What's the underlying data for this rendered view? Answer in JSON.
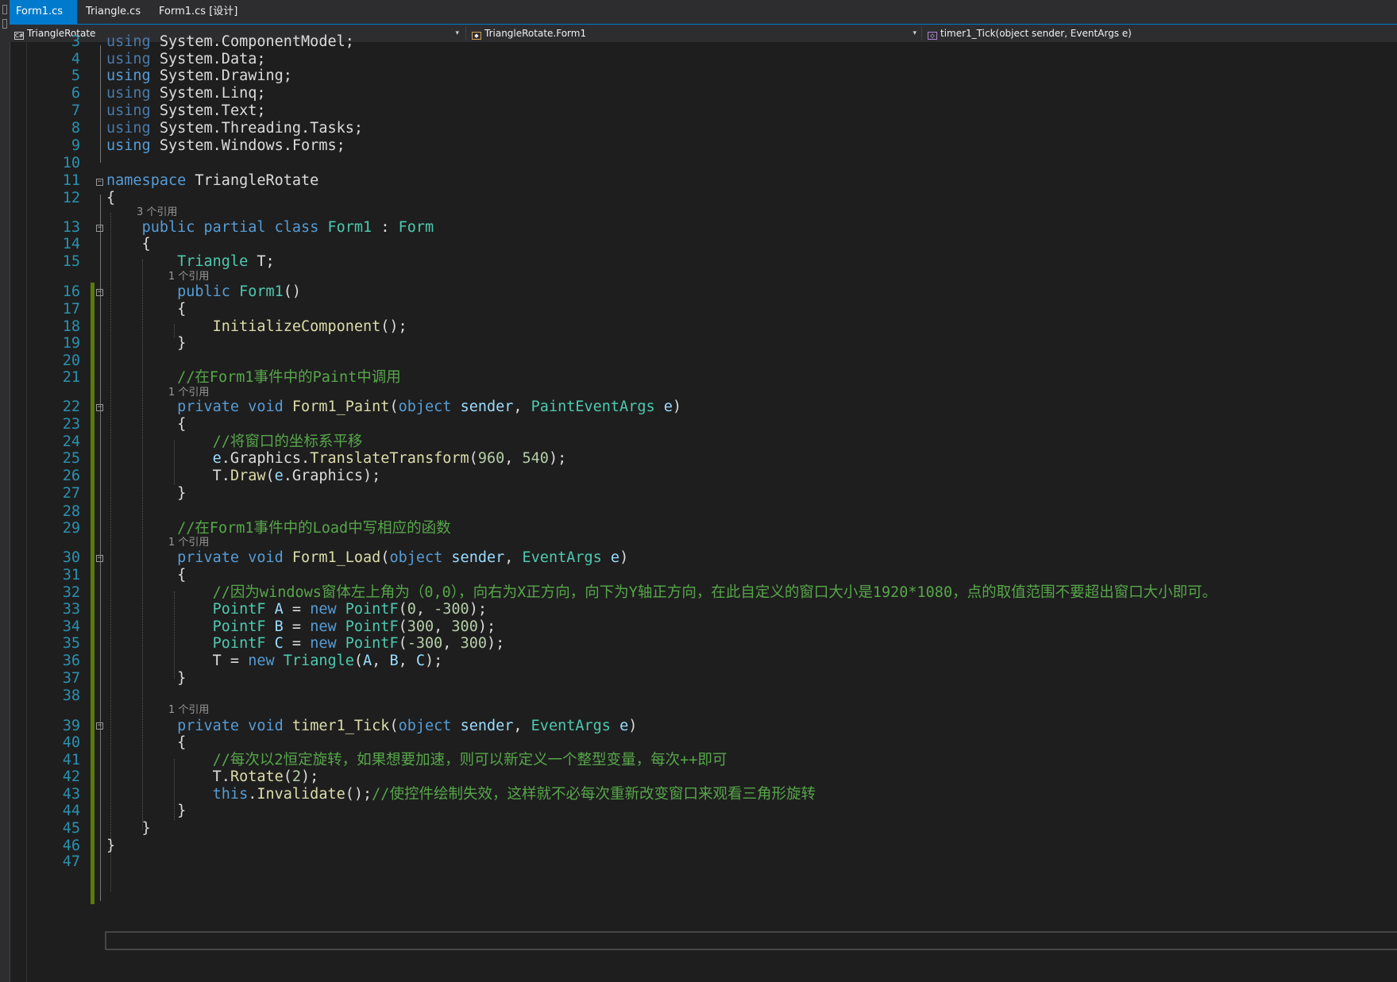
{
  "tabs": [
    {
      "label": "Form1.cs",
      "active": true
    },
    {
      "label": "Triangle.cs",
      "active": false
    },
    {
      "label": "Form1.cs [设计]",
      "active": false
    }
  ],
  "nav": {
    "project": "TriangleRotate",
    "class": "TriangleRotate.Form1",
    "member": "timer1_Tick(object sender, EventArgs e)"
  },
  "refs": {
    "r13": "3 个引用",
    "r16": "1 个引用",
    "r22": "1 个引用",
    "r30": "1 个引用",
    "r39": "1 个引用"
  },
  "lines": [
    {
      "n": "3",
      "tokens": [
        [
          "kw-dim",
          "using"
        ],
        [
          "pl",
          " System.ComponentModel;"
        ]
      ]
    },
    {
      "n": "4",
      "tokens": [
        [
          "kw-dim",
          "using"
        ],
        [
          "pl",
          " System.Data;"
        ]
      ]
    },
    {
      "n": "5",
      "tokens": [
        [
          "kw",
          "using"
        ],
        [
          "pl",
          " System.Drawing;"
        ]
      ]
    },
    {
      "n": "6",
      "tokens": [
        [
          "kw-dim",
          "using"
        ],
        [
          "pl",
          " System.Linq;"
        ]
      ]
    },
    {
      "n": "7",
      "tokens": [
        [
          "kw-dim",
          "using"
        ],
        [
          "pl",
          " System.Text;"
        ]
      ]
    },
    {
      "n": "8",
      "tokens": [
        [
          "kw-dim",
          "using"
        ],
        [
          "pl",
          " System.Threading.Tasks;"
        ]
      ]
    },
    {
      "n": "9",
      "tokens": [
        [
          "kw",
          "using"
        ],
        [
          "pl",
          " System.Windows.Forms;"
        ]
      ]
    },
    {
      "n": "10",
      "tokens": []
    },
    {
      "n": "11",
      "tokens": [
        [
          "kw",
          "namespace"
        ],
        [
          "pl",
          " TriangleRotate"
        ]
      ]
    },
    {
      "n": "12",
      "tokens": [
        [
          "pl",
          "{"
        ]
      ]
    },
    {
      "n": "13",
      "tokens": [
        [
          "pl",
          "    "
        ],
        [
          "kw",
          "public"
        ],
        [
          "pl",
          " "
        ],
        [
          "kw",
          "partial"
        ],
        [
          "pl",
          " "
        ],
        [
          "kw",
          "class"
        ],
        [
          "pl",
          " "
        ],
        [
          "ty",
          "Form1"
        ],
        [
          "pl",
          " : "
        ],
        [
          "ty",
          "Form"
        ]
      ]
    },
    {
      "n": "14",
      "tokens": [
        [
          "pl",
          "    {"
        ]
      ]
    },
    {
      "n": "15",
      "tokens": [
        [
          "pl",
          "        "
        ],
        [
          "ty",
          "Triangle"
        ],
        [
          "pl",
          " T;"
        ]
      ]
    },
    {
      "n": "16",
      "tokens": [
        [
          "pl",
          "        "
        ],
        [
          "kw",
          "public"
        ],
        [
          "pl",
          " "
        ],
        [
          "ty",
          "Form1"
        ],
        [
          "pl",
          "()"
        ]
      ]
    },
    {
      "n": "17",
      "tokens": [
        [
          "pl",
          "        {"
        ]
      ]
    },
    {
      "n": "18",
      "tokens": [
        [
          "pl",
          "            "
        ],
        [
          "fn",
          "InitializeComponent"
        ],
        [
          "pl",
          "();"
        ]
      ]
    },
    {
      "n": "19",
      "tokens": [
        [
          "pl",
          "        }"
        ]
      ]
    },
    {
      "n": "20",
      "tokens": []
    },
    {
      "n": "21",
      "tokens": [
        [
          "pl",
          "        "
        ],
        [
          "cm",
          "//在Form1事件中的Paint中调用"
        ]
      ]
    },
    {
      "n": "22",
      "tokens": [
        [
          "pl",
          "        "
        ],
        [
          "kw",
          "private"
        ],
        [
          "pl",
          " "
        ],
        [
          "kw",
          "void"
        ],
        [
          "pl",
          " "
        ],
        [
          "fn",
          "Form1_Paint"
        ],
        [
          "pl",
          "("
        ],
        [
          "kw",
          "object"
        ],
        [
          "pl",
          " "
        ],
        [
          "id",
          "sender"
        ],
        [
          "pl",
          ", "
        ],
        [
          "ty",
          "PaintEventArgs"
        ],
        [
          "pl",
          " "
        ],
        [
          "id",
          "e"
        ],
        [
          "pl",
          ")"
        ]
      ]
    },
    {
      "n": "23",
      "tokens": [
        [
          "pl",
          "        {"
        ]
      ]
    },
    {
      "n": "24",
      "tokens": [
        [
          "pl",
          "            "
        ],
        [
          "cm",
          "//将窗口的坐标系平移"
        ]
      ]
    },
    {
      "n": "25",
      "tokens": [
        [
          "pl",
          "            "
        ],
        [
          "id",
          "e"
        ],
        [
          "pl",
          ".Graphics."
        ],
        [
          "fn",
          "TranslateTransform"
        ],
        [
          "pl",
          "("
        ],
        [
          "nm",
          "960"
        ],
        [
          "pl",
          ", "
        ],
        [
          "nm",
          "540"
        ],
        [
          "pl",
          ");"
        ]
      ]
    },
    {
      "n": "26",
      "tokens": [
        [
          "pl",
          "            T."
        ],
        [
          "fn",
          "Draw"
        ],
        [
          "pl",
          "("
        ],
        [
          "id",
          "e"
        ],
        [
          "pl",
          ".Graphics);"
        ]
      ]
    },
    {
      "n": "27",
      "tokens": [
        [
          "pl",
          "        }"
        ]
      ]
    },
    {
      "n": "28",
      "tokens": []
    },
    {
      "n": "29",
      "tokens": [
        [
          "pl",
          "        "
        ],
        [
          "cm",
          "//在Form1事件中的Load中写相应的函数"
        ]
      ]
    },
    {
      "n": "30",
      "tokens": [
        [
          "pl",
          "        "
        ],
        [
          "kw",
          "private"
        ],
        [
          "pl",
          " "
        ],
        [
          "kw",
          "void"
        ],
        [
          "pl",
          " "
        ],
        [
          "fn",
          "Form1_Load"
        ],
        [
          "pl",
          "("
        ],
        [
          "kw",
          "object"
        ],
        [
          "pl",
          " "
        ],
        [
          "id",
          "sender"
        ],
        [
          "pl",
          ", "
        ],
        [
          "ty",
          "EventArgs"
        ],
        [
          "pl",
          " "
        ],
        [
          "id",
          "e"
        ],
        [
          "pl",
          ")"
        ]
      ]
    },
    {
      "n": "31",
      "tokens": [
        [
          "pl",
          "        {"
        ]
      ]
    },
    {
      "n": "32",
      "tokens": [
        [
          "pl",
          "            "
        ],
        [
          "cm",
          "//因为windows窗体左上角为（0,0），向右为X正方向，向下为Y轴正方向，在此自定义的窗口大小是1920*1080，点的取值范围不要超出窗口大小即可。"
        ]
      ]
    },
    {
      "n": "33",
      "tokens": [
        [
          "pl",
          "            "
        ],
        [
          "ty",
          "PointF"
        ],
        [
          "pl",
          " "
        ],
        [
          "id",
          "A"
        ],
        [
          "pl",
          " = "
        ],
        [
          "kw",
          "new"
        ],
        [
          "pl",
          " "
        ],
        [
          "ty",
          "PointF"
        ],
        [
          "pl",
          "("
        ],
        [
          "nm",
          "0"
        ],
        [
          "pl",
          ", "
        ],
        [
          "nm",
          "-300"
        ],
        [
          "pl",
          ");"
        ]
      ]
    },
    {
      "n": "34",
      "tokens": [
        [
          "pl",
          "            "
        ],
        [
          "ty",
          "PointF"
        ],
        [
          "pl",
          " "
        ],
        [
          "id",
          "B"
        ],
        [
          "pl",
          " = "
        ],
        [
          "kw",
          "new"
        ],
        [
          "pl",
          " "
        ],
        [
          "ty",
          "PointF"
        ],
        [
          "pl",
          "("
        ],
        [
          "nm",
          "300"
        ],
        [
          "pl",
          ", "
        ],
        [
          "nm",
          "300"
        ],
        [
          "pl",
          ");"
        ]
      ]
    },
    {
      "n": "35",
      "tokens": [
        [
          "pl",
          "            "
        ],
        [
          "ty",
          "PointF"
        ],
        [
          "pl",
          " "
        ],
        [
          "id",
          "C"
        ],
        [
          "pl",
          " = "
        ],
        [
          "kw",
          "new"
        ],
        [
          "pl",
          " "
        ],
        [
          "ty",
          "PointF"
        ],
        [
          "pl",
          "("
        ],
        [
          "nm",
          "-300"
        ],
        [
          "pl",
          ", "
        ],
        [
          "nm",
          "300"
        ],
        [
          "pl",
          ");"
        ]
      ]
    },
    {
      "n": "36",
      "tokens": [
        [
          "pl",
          "            T = "
        ],
        [
          "kw",
          "new"
        ],
        [
          "pl",
          " "
        ],
        [
          "ty",
          "Triangle"
        ],
        [
          "pl",
          "("
        ],
        [
          "id",
          "A"
        ],
        [
          "pl",
          ", "
        ],
        [
          "id",
          "B"
        ],
        [
          "pl",
          ", "
        ],
        [
          "id",
          "C"
        ],
        [
          "pl",
          ");"
        ]
      ]
    },
    {
      "n": "37",
      "tokens": [
        [
          "pl",
          "        }"
        ]
      ]
    },
    {
      "n": "38",
      "tokens": []
    },
    {
      "n": "39",
      "tokens": [
        [
          "pl",
          "        "
        ],
        [
          "kw",
          "private"
        ],
        [
          "pl",
          " "
        ],
        [
          "kw",
          "void"
        ],
        [
          "pl",
          " "
        ],
        [
          "fn",
          "timer1_Tick"
        ],
        [
          "pl",
          "("
        ],
        [
          "kw",
          "object"
        ],
        [
          "pl",
          " "
        ],
        [
          "id",
          "sender"
        ],
        [
          "pl",
          ", "
        ],
        [
          "ty",
          "EventArgs"
        ],
        [
          "pl",
          " "
        ],
        [
          "id",
          "e"
        ],
        [
          "pl",
          ")"
        ]
      ]
    },
    {
      "n": "40",
      "tokens": [
        [
          "pl",
          "        {"
        ]
      ]
    },
    {
      "n": "41",
      "tokens": [
        [
          "pl",
          "            "
        ],
        [
          "cm",
          "//每次以2恒定旋转，如果想要加速，则可以新定义一个整型变量，每次++即可"
        ]
      ]
    },
    {
      "n": "42",
      "tokens": [
        [
          "pl",
          "            T."
        ],
        [
          "fn",
          "Rotate"
        ],
        [
          "pl",
          "("
        ],
        [
          "nm",
          "2"
        ],
        [
          "pl",
          ");"
        ]
      ]
    },
    {
      "n": "43",
      "tokens": [
        [
          "pl",
          "            "
        ],
        [
          "kw",
          "this"
        ],
        [
          "pl",
          "."
        ],
        [
          "fn",
          "Invalidate"
        ],
        [
          "pl",
          "();"
        ],
        [
          "cm",
          "//使控件绘制失效，这样就不必每次重新改变窗口来观看三角形旋转"
        ]
      ]
    },
    {
      "n": "44",
      "tokens": [
        [
          "pl",
          "        }"
        ]
      ]
    },
    {
      "n": "45",
      "tokens": [
        [
          "pl",
          "    }"
        ]
      ]
    },
    {
      "n": "46",
      "tokens": [
        [
          "pl",
          "}"
        ]
      ]
    },
    {
      "n": "47",
      "tokens": []
    }
  ]
}
